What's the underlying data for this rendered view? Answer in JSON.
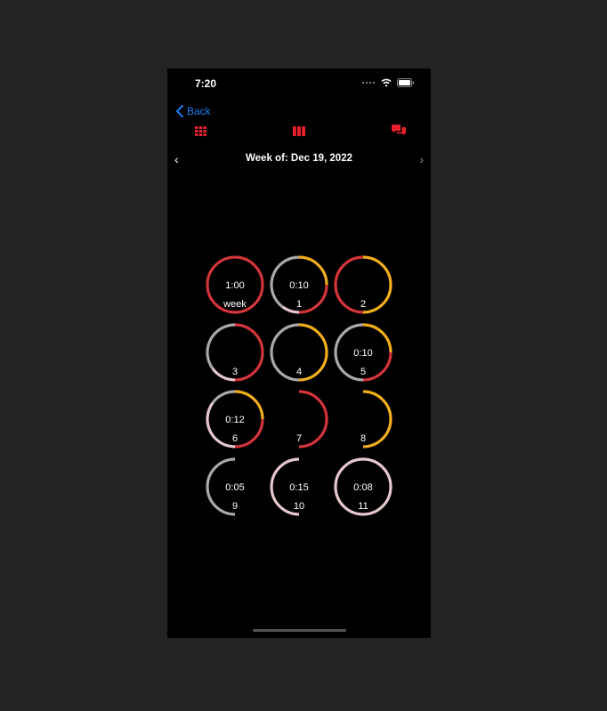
{
  "status": {
    "time": "7:20"
  },
  "nav": {
    "back_label": "Back"
  },
  "week": {
    "title": "Week of: Dec 19, 2022"
  },
  "colors": {
    "accent": "#e8202d",
    "red": "#d3353b",
    "orange": "#f1ae1b",
    "gray": "#a9a9a9",
    "pink": "#e6c8cc",
    "link": "#1d7cf2"
  },
  "toolbar": {
    "left_icon": "grid-icon",
    "center_icon": "columns-icon",
    "right_icon": "chat-icon"
  },
  "rings": [
    {
      "top": "1:00",
      "bottom": "week",
      "arcs": [
        {
          "color": "red",
          "from": 0,
          "to": 1
        }
      ]
    },
    {
      "top": "0:10",
      "bottom": "1",
      "arcs": [
        {
          "color": "orange",
          "from": 0,
          "to": 0.25
        },
        {
          "color": "red",
          "from": 0.25,
          "to": 0.5
        },
        {
          "color": "pink",
          "from": 0.5,
          "to": 0.6
        },
        {
          "color": "gray",
          "from": 0.6,
          "to": 1
        }
      ]
    },
    {
      "top": "",
      "bottom": "2",
      "arcs": [
        {
          "color": "orange",
          "from": 0,
          "to": 0.5
        },
        {
          "color": "red",
          "from": 0.5,
          "to": 1
        }
      ]
    },
    {
      "top": "",
      "bottom": "3",
      "arcs": [
        {
          "color": "red",
          "from": 0,
          "to": 0.5
        },
        {
          "color": "pink",
          "from": 0.5,
          "to": 0.65
        },
        {
          "color": "gray",
          "from": 0.65,
          "to": 1
        }
      ]
    },
    {
      "top": "",
      "bottom": "4",
      "arcs": [
        {
          "color": "orange",
          "from": 0,
          "to": 0.5
        },
        {
          "color": "gray",
          "from": 0.5,
          "to": 1
        }
      ]
    },
    {
      "top": "0:10",
      "bottom": "5",
      "arcs": [
        {
          "color": "orange",
          "from": 0,
          "to": 0.25
        },
        {
          "color": "red",
          "from": 0.25,
          "to": 0.5
        },
        {
          "color": "gray",
          "from": 0.5,
          "to": 1
        }
      ]
    },
    {
      "top": "0:12",
      "bottom": "6",
      "arcs": [
        {
          "color": "orange",
          "from": 0,
          "to": 0.25
        },
        {
          "color": "red",
          "from": 0.25,
          "to": 0.5
        },
        {
          "color": "pink",
          "from": 0.5,
          "to": 0.85
        },
        {
          "color": "gray",
          "from": 0.85,
          "to": 1
        }
      ]
    },
    {
      "top": "",
      "bottom": "7",
      "arcs": [
        {
          "color": "red",
          "from": 0,
          "to": 0.5
        }
      ]
    },
    {
      "top": "",
      "bottom": "8",
      "arcs": [
        {
          "color": "orange",
          "from": 0,
          "to": 0.5
        }
      ]
    },
    {
      "top": "0:05",
      "bottom": "9",
      "arcs": [
        {
          "color": "gray",
          "from": 0.5,
          "to": 1
        }
      ]
    },
    {
      "top": "0:15",
      "bottom": "10",
      "arcs": [
        {
          "color": "pink",
          "from": 0.5,
          "to": 1
        }
      ]
    },
    {
      "top": "0:08",
      "bottom": "11",
      "arcs": [
        {
          "color": "pink",
          "from": 0,
          "to": 1
        }
      ]
    }
  ]
}
